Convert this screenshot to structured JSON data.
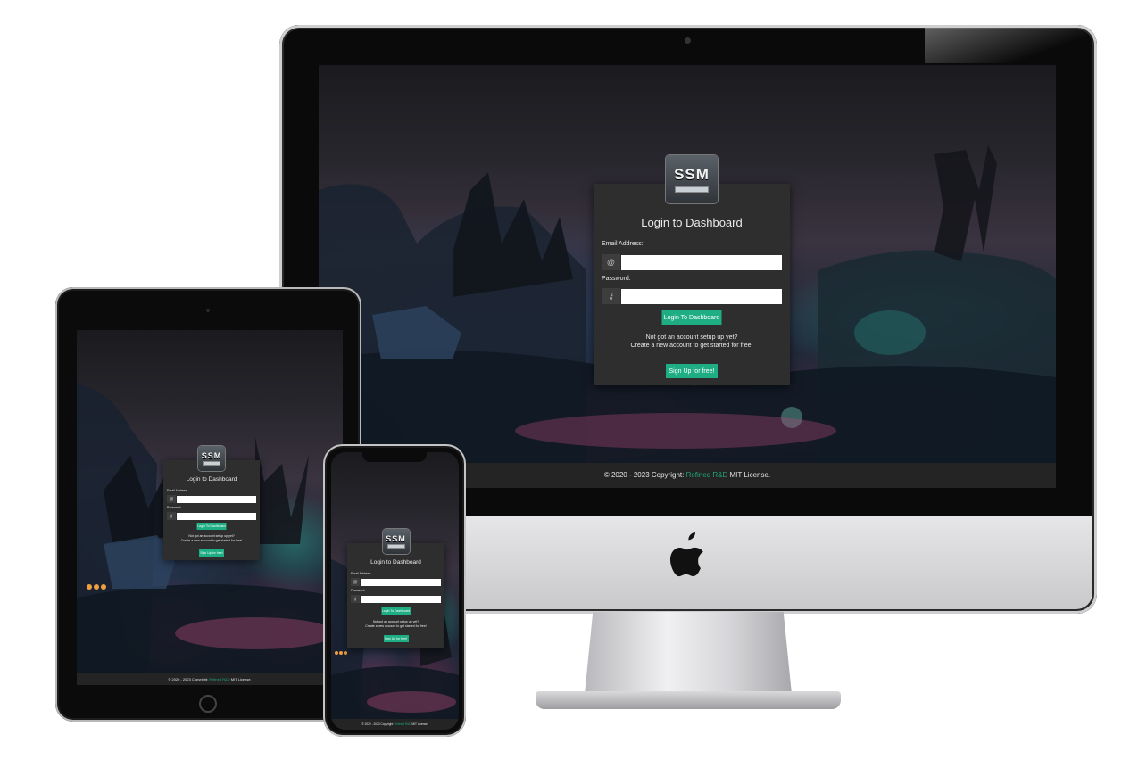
{
  "login": {
    "title": "Login to Dashboard",
    "email_label": "Email Address:",
    "password_label": "Password:",
    "login_button": "Login To Dashboard",
    "note_line1": "Not got an account setup up yet?",
    "note_line2": "Create a new account to get started for free!",
    "signup_button": "Sign Up for free!",
    "logo_text": "SSM",
    "email_icon": "at-icon",
    "password_icon": "key-icon"
  },
  "footer": {
    "prefix": "© 2020 - 2023 Copyright:",
    "link": "Refined R&D",
    "suffix": "MIT License."
  },
  "colors": {
    "accent": "#1fae84",
    "card_bg": "#2e2e2e",
    "footer_bg": "#242424"
  }
}
